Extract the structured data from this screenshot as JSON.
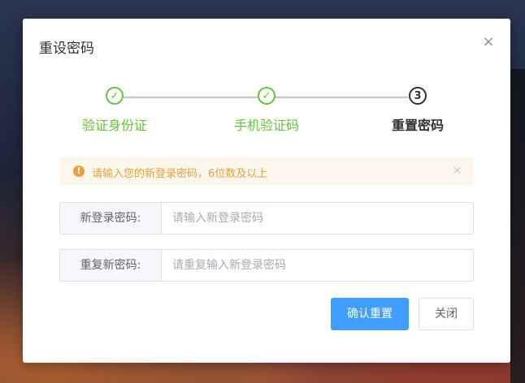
{
  "dialog": {
    "title": "重设密码",
    "close_icon": "close-icon"
  },
  "steps": [
    {
      "label": "验证身份证",
      "status": "done",
      "icon": "check-icon"
    },
    {
      "label": "手机验证码",
      "status": "done",
      "icon": "check-icon"
    },
    {
      "label": "重置密码",
      "status": "current",
      "number": "3"
    }
  ],
  "alert": {
    "text": "请输入您的新登录密码，6位数及以上",
    "icon": "warning-icon",
    "close_icon": "close-icon"
  },
  "form": {
    "new_password": {
      "label": "新登录密码:",
      "value": "",
      "placeholder": "请输入新登录密码"
    },
    "repeat_password": {
      "label": "重复新密码:",
      "value": "",
      "placeholder": "请重复输入新登录密码"
    }
  },
  "buttons": {
    "confirm": "确认重置",
    "close": "关闭"
  },
  "colors": {
    "success": "#67c23a",
    "primary": "#409eff",
    "warning": "#e6a23c",
    "warning_bg": "#fdf6ec"
  }
}
